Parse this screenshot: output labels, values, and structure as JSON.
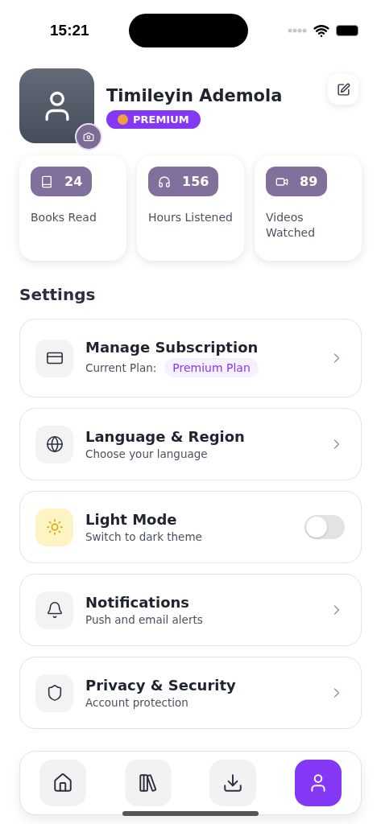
{
  "status_bar": {
    "time": "15:21"
  },
  "profile": {
    "name": "Timileyin Ademola",
    "badge": "PREMIUM"
  },
  "stats": [
    {
      "kind": "book",
      "value": "24",
      "label": "Books Read"
    },
    {
      "kind": "headphones",
      "value": "156",
      "label": "Hours Listened"
    },
    {
      "kind": "video",
      "value": "89",
      "label": "Videos Watched"
    }
  ],
  "settings_title": "Settings",
  "settings": [
    {
      "kind": "card",
      "title": "Manage Subscription",
      "subtitle": "Current Plan:",
      "tag": "Premium Plan"
    },
    {
      "kind": "globe",
      "title": "Language & Region",
      "subtitle": "Choose your language"
    },
    {
      "kind": "sun",
      "title": "Light Mode",
      "subtitle": "Switch to dark theme",
      "on": false
    },
    {
      "kind": "bell",
      "title": "Notifications",
      "subtitle": "Push and email alerts"
    },
    {
      "kind": "shield",
      "title": "Privacy & Security",
      "subtitle": "Account protection"
    }
  ],
  "nav": [
    {
      "kind": "home",
      "selected": false
    },
    {
      "kind": "library",
      "selected": false
    },
    {
      "kind": "download",
      "selected": false
    },
    {
      "kind": "profile",
      "selected": true
    }
  ]
}
